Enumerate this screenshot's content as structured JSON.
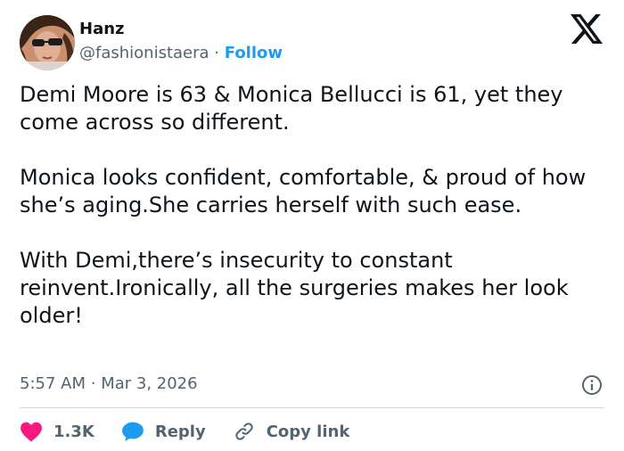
{
  "author": {
    "name": "Hanz",
    "handle": "@fashionistaera",
    "separator": "·",
    "follow_label": "Follow"
  },
  "tweet": {
    "paragraphs": [
      "Demi Moore is 63 & Monica Bellucci is 61, yet they come across so different.",
      "Monica looks confident, comfortable, & proud of how she’s aging.She carries herself with such ease.",
      "With Demi,there’s insecurity to constant reinvent.Ironically, all the surgeries makes her look older!"
    ],
    "time": "5:57 AM",
    "separator": "·",
    "date": "Mar 3, 2026"
  },
  "actions": {
    "likes": "1.3K",
    "reply_label": "Reply",
    "copy_link_label": "Copy link"
  },
  "icons": {
    "brand": "x-logo-icon",
    "info": "info-icon",
    "like": "heart-icon",
    "reply": "speech-bubble-icon",
    "copy": "link-icon"
  },
  "colors": {
    "text": "#0f1419",
    "muted": "#536471",
    "accent": "#1d9bf0",
    "like": "#f91880",
    "divider": "#cfd9de"
  }
}
